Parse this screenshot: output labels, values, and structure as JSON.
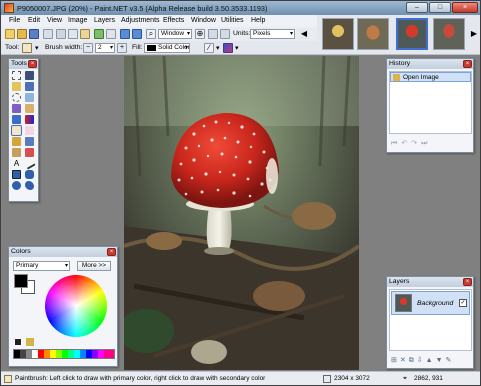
{
  "window": {
    "title": "P9050007.JPG (20%) - Paint.NET v3.5 (Alpha Release build 3.50.3533.1193)",
    "controls": {
      "minimize": "–",
      "maximize": "□",
      "close": "×"
    }
  },
  "menu": [
    "File",
    "Edit",
    "View",
    "Image",
    "Layers",
    "Adjustments",
    "Effects",
    "Window",
    "Utilities",
    "Help"
  ],
  "toolbar": {
    "zoom_value": "Window",
    "units_label": "Units:",
    "units_value": "Pixels",
    "tool_label": "Tool:",
    "brush_width_label": "Brush width:",
    "brush_width_value": "2",
    "fill_label": "Fill:",
    "fill_value": "Solid Color"
  },
  "panels": {
    "tools_title": "Tools",
    "history_title": "History",
    "history_items": [
      "Open Image"
    ],
    "colors_title": "Colors",
    "colors_mode": "Primary",
    "colors_more": "More >>",
    "layers_title": "Layers",
    "layer_name": "Background"
  },
  "status": {
    "message": "Paintbrush: Left click to draw with primary color, right click to draw with secondary color",
    "image_size": "2304 x 3072",
    "cursor_pos": "2862, 931"
  },
  "colors": {
    "accent": "#3f6fd0",
    "close_red": "#c63a2f",
    "primary_color": "#000000",
    "secondary_color": "#ffffff"
  }
}
